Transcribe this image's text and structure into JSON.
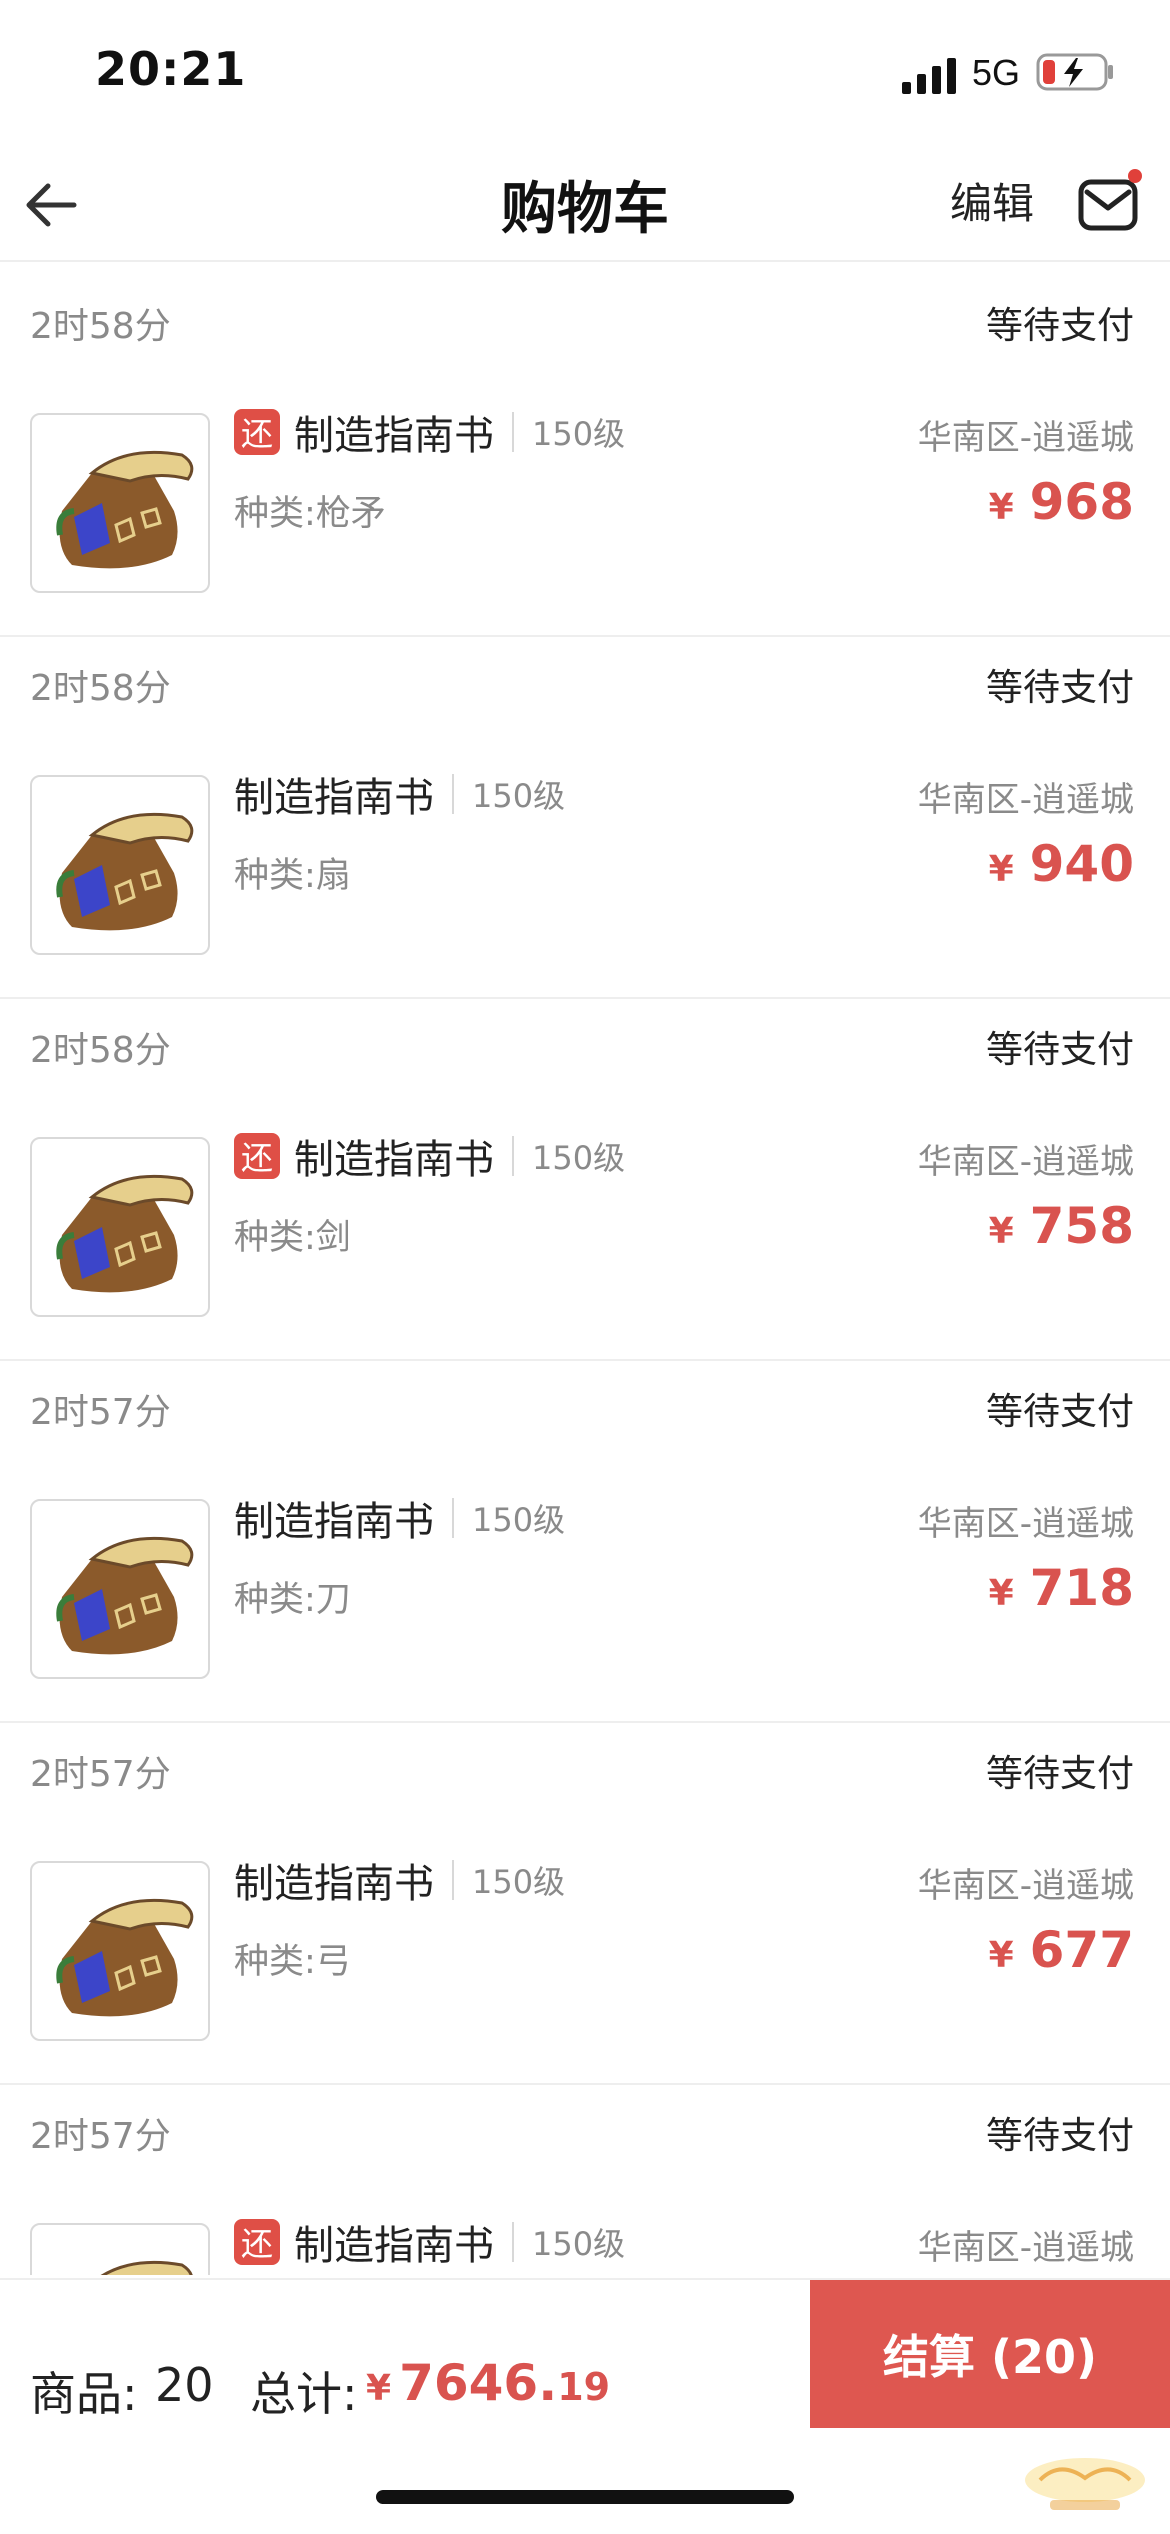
{
  "status": {
    "time": "20:21",
    "network": "5G"
  },
  "header": {
    "title": "购物车",
    "edit": "编辑"
  },
  "orders": [
    {
      "time": "2时58分",
      "status": "等待支付",
      "tag": "还",
      "name": "制造指南书",
      "level": "150级",
      "kind": "种类:枪矛",
      "server": "华南区-逍遥城",
      "currency": "¥",
      "price": "968"
    },
    {
      "time": "2时58分",
      "status": "等待支付",
      "tag": "",
      "name": "制造指南书",
      "level": "150级",
      "kind": "种类:扇",
      "server": "华南区-逍遥城",
      "currency": "¥",
      "price": "940"
    },
    {
      "time": "2时58分",
      "status": "等待支付",
      "tag": "还",
      "name": "制造指南书",
      "level": "150级",
      "kind": "种类:剑",
      "server": "华南区-逍遥城",
      "currency": "¥",
      "price": "758"
    },
    {
      "time": "2时57分",
      "status": "等待支付",
      "tag": "",
      "name": "制造指南书",
      "level": "150级",
      "kind": "种类:刀",
      "server": "华南区-逍遥城",
      "currency": "¥",
      "price": "718"
    },
    {
      "time": "2时57分",
      "status": "等待支付",
      "tag": "",
      "name": "制造指南书",
      "level": "150级",
      "kind": "种类:弓",
      "server": "华南区-逍遥城",
      "currency": "¥",
      "price": "677"
    },
    {
      "time": "2时57分",
      "status": "等待支付",
      "tag": "还",
      "name": "制造指南书",
      "level": "150级",
      "kind": "",
      "server": "华南区-逍遥城",
      "currency": "",
      "price": ""
    }
  ],
  "footer": {
    "count_label": "商品:",
    "count": "20",
    "total_label": "总计:",
    "currency": "¥",
    "total_int": "7646.",
    "total_dec": "19",
    "checkout": "结算 (20)"
  },
  "colors": {
    "accent": "#de5750",
    "price": "#d9534f",
    "muted": "#8a8a8a"
  }
}
